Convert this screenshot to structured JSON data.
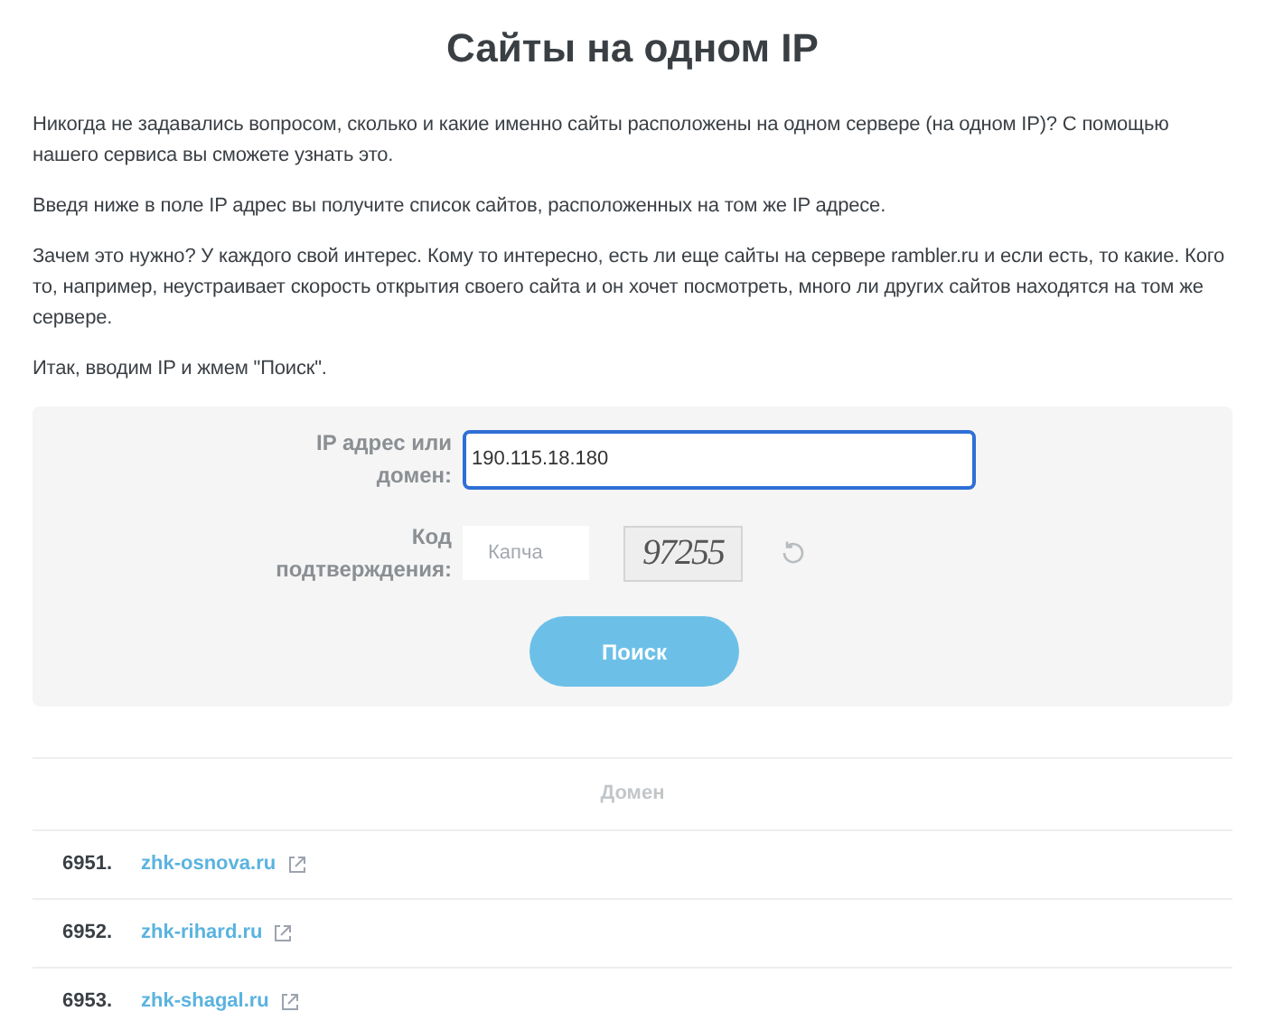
{
  "title": "Сайты на одном IP",
  "paragraphs": [
    "Никогда не задавались вопросом, сколько и какие именно сайты расположены на одном сервере (на одном IP)? С помощью нашего сервиса вы сможете узнать это.",
    "Введя ниже в поле IP адрес вы получите список сайтов, расположенных на том же IP адресе.",
    "Зачем это нужно? У каждого свой интерес. Кому то интересно, есть ли еще сайты на сервере rambler.ru и если есть, то какие. Кого то, например, неустраивает скорость открытия своего сайта и он хочет посмотреть, много ли других сайтов находятся на том же сервере.",
    "Итак, вводим IP и жмем \"Поиск\"."
  ],
  "form": {
    "ip_label": "IP адрес или домен:",
    "ip_value": "190.115.18.180",
    "captcha_label": "Код подтверждения:",
    "captcha_placeholder": "Капча",
    "captcha_text": "97255",
    "button": "Поиск"
  },
  "table": {
    "columns": [
      "Домен"
    ],
    "rows": [
      {
        "number": "6951.",
        "domain": "zhk-osnova.ru"
      },
      {
        "number": "6952.",
        "domain": "zhk-rihard.ru"
      },
      {
        "number": "6953.",
        "domain": "zhk-shagal.ru"
      }
    ]
  }
}
